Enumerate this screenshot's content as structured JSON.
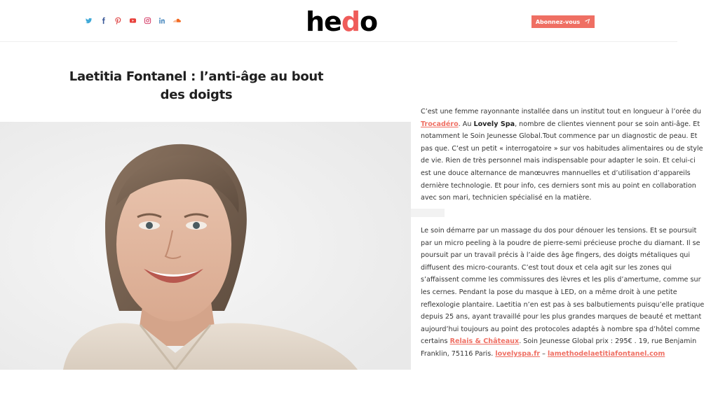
{
  "header": {
    "social": [
      {
        "name": "twitter-icon",
        "glyph": "t"
      },
      {
        "name": "facebook-icon",
        "glyph": "f"
      },
      {
        "name": "pinterest-icon",
        "glyph": "p"
      },
      {
        "name": "youtube-icon",
        "glyph": "y"
      },
      {
        "name": "instagram-icon",
        "glyph": "i"
      },
      {
        "name": "linkedin-icon",
        "glyph": "in"
      },
      {
        "name": "soundcloud-icon",
        "glyph": "s"
      }
    ],
    "logo_part1": "he",
    "logo_accent": "d",
    "logo_part2": "o",
    "subscribe_label": "Abonnez-vous",
    "accent_color": "#ef6f63"
  },
  "article": {
    "title": "Laetitia Fontanel : l’anti-âge au bout des doigts",
    "p1": {
      "t1": "C’est une femme rayonnante installée dans un institut tout en longueur à l’orée du ",
      "link1": "Trocadéro",
      "t2": ". Au ",
      "bold1": "Lovely Spa",
      "t3": ", nombre de clientes viennent pour se soin anti-âge. Et notamment le Soin Jeunesse Global.Tout commence par un diagnostic de peau. Et pas que. C’est un petit « interrogatoire » sur vos habitudes alimentaires ou de style de vie. Rien de très personnel mais indispensable pour adapter le soin. Et celui-ci est une douce alternance de manœuvres mannuelles et d’utilisation d’appareils dernière technologie. Et pour info, ces derniers sont mis au point en collaboration avec son mari, technicien spécialisé en la matière."
    },
    "p2": {
      "t1": "Le soin démarre par un massage du dos pour dénouer les tensions. Et se poursuit par un micro peeling à la poudre de pierre-semi précieuse proche du diamant. Il se poursuit par un travail précis à l’aide des âge fingers, des doigts métaliques qui diffusent des micro-courants. C’est tout doux et cela agit sur les zones qui s’affaissent comme les commissures des lèvres et les plis d’amertume, comme sur les cernes. Pendant la pose du masque à LED, on a même droit à une petite reflexologie plantaire. Laetitia n’en est pas à ses balbutiements puisqu’elle pratique depuis 25 ans, ayant travaillé pour les plus grandes marques de beauté et mettant aujourd’hui toujours au point des protocoles adaptés à nombre spa d’hôtel comme certains ",
      "link1": "Relais & Châteaux",
      "t2": ". Soin Jeunesse Global prix : 295€ . 19, rue Benjamin Franklin, 75116 Paris. ",
      "link2": "lovelyspa.fr",
      "t3": " – ",
      "link3": "lamethodelaetitiafontanel.com"
    }
  }
}
